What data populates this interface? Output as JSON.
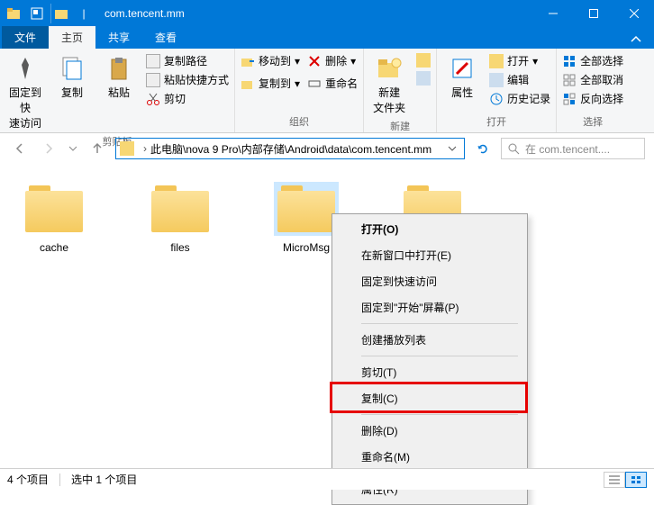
{
  "title": "com.tencent.mm",
  "tabs": {
    "file": "文件",
    "home": "主页",
    "share": "共享",
    "view": "查看"
  },
  "ribbon": {
    "groups": {
      "clipboard": {
        "label": "剪贴板",
        "pin": "固定到快\n速访问",
        "copy": "复制",
        "paste": "粘贴",
        "copy_path": "复制路径",
        "paste_shortcut": "粘贴快捷方式",
        "cut": "剪切"
      },
      "organize": {
        "label": "组织",
        "move_to": "移动到",
        "copy_to": "复制到",
        "delete": "删除",
        "rename": "重命名"
      },
      "new": {
        "label": "新建",
        "new_folder": "新建\n文件夹"
      },
      "open": {
        "label": "打开",
        "properties": "属性",
        "open": "打开",
        "edit": "编辑",
        "history": "历史记录"
      },
      "select": {
        "label": "选择",
        "select_all": "全部选择",
        "select_none": "全部取消",
        "invert": "反向选择"
      }
    }
  },
  "address": {
    "sep": "›",
    "path": "此电脑\\nova 9 Pro\\内部存储\\Android\\data\\com.tencent.mm"
  },
  "search_placeholder": "在 com.tencent....",
  "folders": [
    {
      "name": "cache",
      "selected": false
    },
    {
      "name": "files",
      "selected": false
    },
    {
      "name": "MicroMsg",
      "selected": true
    },
    {
      "name": "",
      "selected": false
    }
  ],
  "context_menu": [
    {
      "label": "打开(O)",
      "bold": true
    },
    {
      "label": "在新窗口中打开(E)"
    },
    {
      "label": "固定到快速访问"
    },
    {
      "label": "固定到\"开始\"屏幕(P)"
    },
    {
      "sep": true
    },
    {
      "label": "创建播放列表"
    },
    {
      "sep": true
    },
    {
      "label": "剪切(T)"
    },
    {
      "label": "复制(C)",
      "highlight": true
    },
    {
      "sep": true
    },
    {
      "label": "删除(D)"
    },
    {
      "label": "重命名(M)"
    },
    {
      "sep": true
    },
    {
      "label": "属性(R)"
    }
  ],
  "status": {
    "count": "4 个项目",
    "selected": "选中 1 个项目"
  }
}
